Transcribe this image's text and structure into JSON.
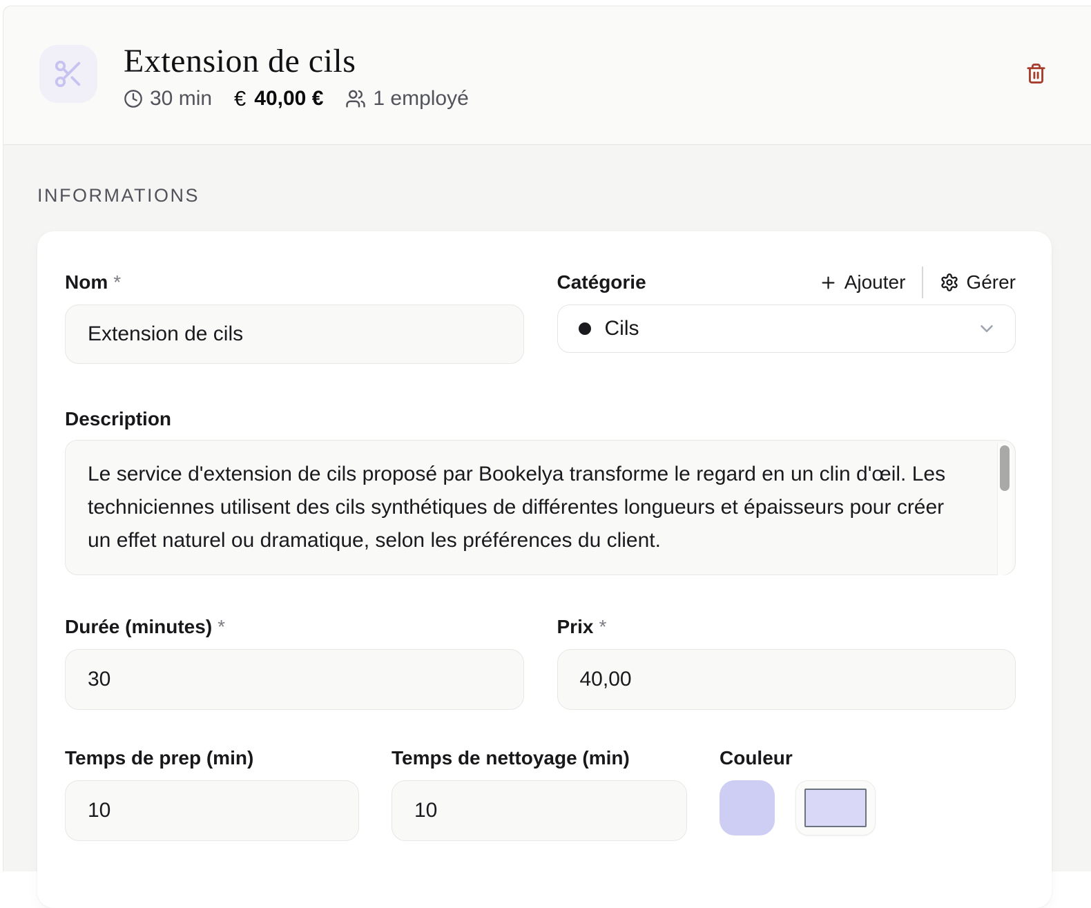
{
  "header": {
    "title": "Extension de cils",
    "duration": "30 min",
    "currency": "€",
    "price": "40,00 €",
    "employees": "1 employé"
  },
  "section_title": "INFORMATIONS",
  "form": {
    "name": {
      "label": "Nom",
      "required_mark": "*",
      "value": "Extension de cils"
    },
    "category": {
      "label": "Catégorie",
      "add": "Ajouter",
      "manage": "Gérer",
      "selected": "Cils"
    },
    "description": {
      "label": "Description",
      "value": "Le service d'extension de cils proposé par Bookelya transforme le regard en un clin d'œil. Les techniciennes utilisent des cils synthétiques de différentes longueurs et épaisseurs pour créer un effet naturel ou dramatique, selon les préférences du client."
    },
    "duration": {
      "label": "Durée (minutes)",
      "required_mark": "*",
      "value": "30"
    },
    "price": {
      "label": "Prix",
      "required_mark": "*",
      "value": "40,00"
    },
    "prep_time": {
      "label": "Temps de prep (min)",
      "value": "10"
    },
    "cleanup_time": {
      "label": "Temps de nettoyage (min)",
      "value": "10"
    },
    "color": {
      "label": "Couleur",
      "value": "#cecdf3"
    }
  },
  "colors": {
    "accent_swatch": "#cecdf3",
    "category_dot": "#1a1a1e",
    "delete_icon": "#a63c2c",
    "service_icon": "#c7c3f1"
  }
}
